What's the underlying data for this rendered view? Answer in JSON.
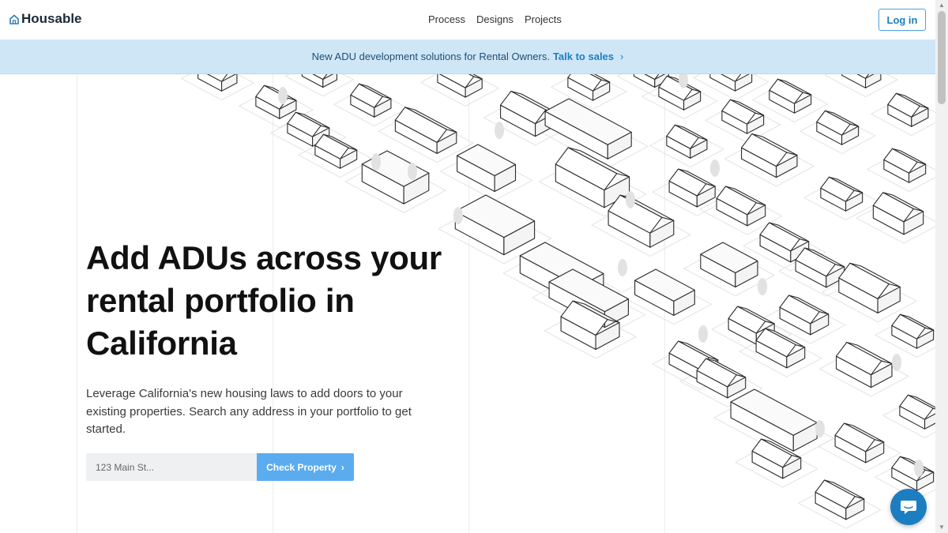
{
  "brand": {
    "name": "Housable",
    "logo_icon": "house-icon"
  },
  "nav": {
    "items": [
      "Process",
      "Designs",
      "Projects"
    ]
  },
  "header": {
    "login_label": "Log in"
  },
  "banner": {
    "text": "New ADU development solutions for Rental Owners.",
    "link_label": "Talk to sales",
    "chevron": "›"
  },
  "hero": {
    "title": "Add ADUs across your rental portfolio in California",
    "description": "Leverage California's new housing laws to add doors to your existing properties. Search any address in your portfolio to get started."
  },
  "search": {
    "placeholder": "123 Main St...",
    "button_label": "Check Property",
    "button_chevron": "›"
  },
  "chat": {
    "icon": "chat-bubble-icon"
  },
  "colors": {
    "accent": "#1c7ec0",
    "banner_bg": "#cfe6f7",
    "button_bg": "#5aacef"
  }
}
